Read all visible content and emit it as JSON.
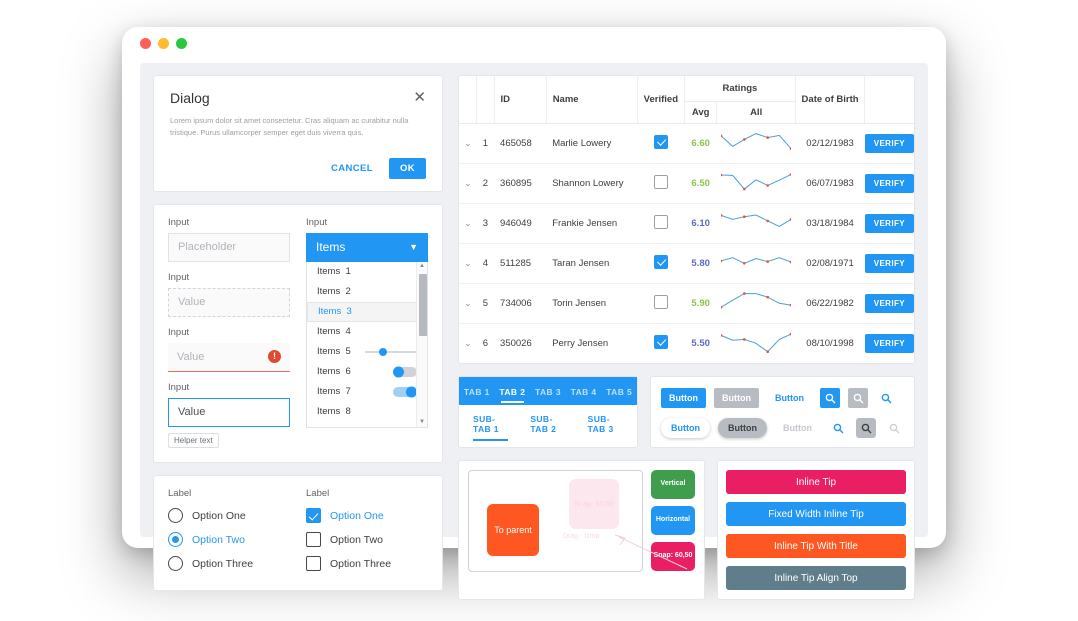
{
  "window": {
    "traffic_lights": [
      "red",
      "yellow",
      "green"
    ]
  },
  "dialog": {
    "title": "Dialog",
    "body": "Lorem ipsum dolor sit amet consectetur. Cras aliquam ac curabitur nulla tristique. Purus ullamcorper semper eget duis viverra quis.",
    "close_icon": "close-icon",
    "cancel_label": "CANCEL",
    "ok_label": "OK"
  },
  "form": {
    "inputs": [
      {
        "label": "Input",
        "value": "Placeholder",
        "state": "placeholder"
      },
      {
        "label": "Input",
        "value": "Value",
        "state": "dashed"
      },
      {
        "label": "Input",
        "value": "Value",
        "state": "error"
      },
      {
        "label": "Input",
        "value": "Value",
        "state": "focus"
      }
    ],
    "helper_text": "Helper text",
    "select": {
      "label": "Input",
      "selected": "Items",
      "caret_icon": "chevron-down-icon",
      "options": [
        {
          "label": "Items",
          "num": "1",
          "widget": "none"
        },
        {
          "label": "Items",
          "num": "2",
          "widget": "none"
        },
        {
          "label": "Items",
          "num": "3",
          "widget": "none",
          "selected": true
        },
        {
          "label": "Items",
          "num": "4",
          "widget": "none"
        },
        {
          "label": "Items",
          "num": "5",
          "widget": "slider"
        },
        {
          "label": "Items",
          "num": "6",
          "widget": "toggle-off"
        },
        {
          "label": "Items",
          "num": "7",
          "widget": "toggle-on"
        },
        {
          "label": "Items",
          "num": "8",
          "widget": "none"
        }
      ]
    }
  },
  "choices": {
    "radio_group": {
      "label": "Label",
      "options": [
        {
          "label": "Option One",
          "checked": false
        },
        {
          "label": "Option Two",
          "checked": true
        },
        {
          "label": "Option Three",
          "checked": false
        }
      ]
    },
    "checkbox_group": {
      "label": "Label",
      "options": [
        {
          "label": "Option One",
          "checked": true
        },
        {
          "label": "Option Two",
          "checked": false
        },
        {
          "label": "Option Three",
          "checked": false
        }
      ]
    }
  },
  "table": {
    "headers": {
      "id": "ID",
      "name": "Name",
      "verified": "Verified",
      "ratings": "Ratings",
      "avg": "Avg",
      "all": "All",
      "dob": "Date of Birth"
    },
    "action_label": "VERIFY",
    "expand_icon": "chevron-down-icon",
    "rows": [
      {
        "idx": "1",
        "id": "465058",
        "name": "Marlie Lowery",
        "verified": true,
        "avg": "6.60",
        "avg_color": "green",
        "dob": "02/12/1983",
        "spark": [
          0.78,
          0.3,
          0.62,
          0.88,
          0.7,
          0.8,
          0.2
        ]
      },
      {
        "idx": "2",
        "id": "360895",
        "name": "Shannon Lowery",
        "verified": false,
        "avg": "6.50",
        "avg_color": "green",
        "dob": "06/07/1983",
        "spark": [
          0.82,
          0.8,
          0.18,
          0.6,
          0.34,
          0.58,
          0.84
        ]
      },
      {
        "idx": "3",
        "id": "946049",
        "name": "Frankie Jensen",
        "verified": false,
        "avg": "6.10",
        "avg_color": "indigo",
        "dob": "03/18/1984",
        "spark": [
          0.8,
          0.62,
          0.74,
          0.82,
          0.55,
          0.3,
          0.62
        ]
      },
      {
        "idx": "4",
        "id": "511285",
        "name": "Taran Jensen",
        "verified": true,
        "avg": "5.80",
        "avg_color": "indigo",
        "dob": "02/08/1971",
        "spark": [
          0.55,
          0.7,
          0.44,
          0.66,
          0.52,
          0.7,
          0.5
        ]
      },
      {
        "idx": "5",
        "id": "734006",
        "name": "Torin Jensen",
        "verified": false,
        "avg": "5.90",
        "avg_color": "green",
        "dob": "06/22/1982",
        "spark": [
          0.26,
          0.58,
          0.88,
          0.88,
          0.72,
          0.44,
          0.36
        ]
      },
      {
        "idx": "6",
        "id": "350026",
        "name": "Perry Jensen",
        "verified": true,
        "avg": "5.50",
        "avg_color": "indigo",
        "dob": "08/10/1998",
        "spark": [
          0.8,
          0.58,
          0.62,
          0.44,
          0.06,
          0.62,
          0.86
        ]
      }
    ]
  },
  "tabs": {
    "main": [
      {
        "label": "TAB 1",
        "active": false
      },
      {
        "label": "TAB 2",
        "active": true
      },
      {
        "label": "TAB 3",
        "active": false
      },
      {
        "label": "TAB 4",
        "active": false
      },
      {
        "label": "TAB 5",
        "active": false
      }
    ],
    "sub": [
      {
        "label": "SUB-TAB 1",
        "active": true
      },
      {
        "label": "SUB-TAB 2",
        "active": false
      },
      {
        "label": "SUB-TAB 3",
        "active": false
      }
    ]
  },
  "buttons": {
    "row1": [
      {
        "label": "Button",
        "style": "pri"
      },
      {
        "label": "Button",
        "style": "sec"
      },
      {
        "label": "Button",
        "style": "txt"
      }
    ],
    "row1_icons": [
      {
        "icon": "search-icon",
        "style": "pri"
      },
      {
        "icon": "search-icon",
        "style": "sec"
      },
      {
        "icon": "search-icon",
        "style": "bare"
      }
    ],
    "row2": [
      {
        "label": "Button",
        "style": "white"
      },
      {
        "label": "Button",
        "style": "gray"
      },
      {
        "label": "Button",
        "style": "dis"
      }
    ],
    "row2_icons": [
      {
        "icon": "search-icon",
        "style": "bare"
      },
      {
        "icon": "search-icon",
        "style": "dark"
      },
      {
        "icon": "search-icon",
        "style": "dis"
      }
    ]
  },
  "dragdrop": {
    "to_parent_label": "To parent",
    "ghost_label": "Snap: 60,50",
    "hint_label": "Drag - Drop",
    "chips": [
      {
        "label": "Vertical",
        "color_class": "v"
      },
      {
        "label": "Horizontal",
        "color_class": "h"
      },
      {
        "label": "Snap: 60,50",
        "color_class": "s"
      }
    ]
  },
  "tips": [
    {
      "label": "Inline Tip",
      "style": "t1"
    },
    {
      "label": "Fixed Width Inline Tip",
      "style": "t2"
    },
    {
      "label": "Inline Tip With Title",
      "style": "t3"
    },
    {
      "label": "Inline Tip Align Top",
      "style": "t4"
    }
  ],
  "colors": {
    "primary": "#2196f3",
    "error": "#e04a32",
    "green": "#8bc34a",
    "indigo": "#5c6bc0",
    "pink": "#e91e63",
    "orange": "#ff5722",
    "slate": "#607d8b"
  }
}
